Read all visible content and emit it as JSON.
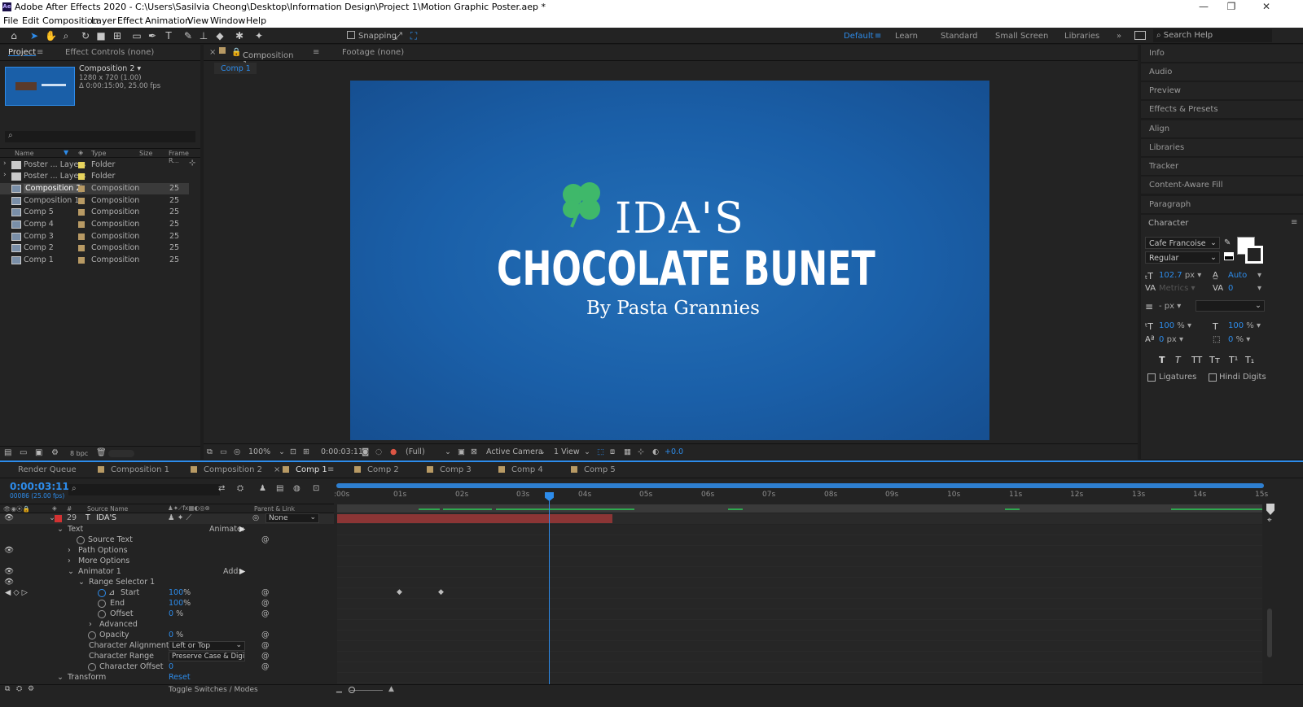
{
  "app": {
    "title": "Adobe After Effects 2020 - C:\\Users\\Sasilvia Cheong\\Desktop\\Information Design\\Project 1\\Motion Graphic Poster.aep *",
    "logo": "Ae"
  },
  "menu": [
    "File",
    "Edit",
    "Composition",
    "Layer",
    "Effect",
    "Animation",
    "View",
    "Window",
    "Help"
  ],
  "toolbar": {
    "snapping": "Snapping",
    "workspaces": [
      "Default",
      "Learn",
      "Standard",
      "Small Screen",
      "Libraries"
    ],
    "search_placeholder": "Search Help"
  },
  "project": {
    "tabs": {
      "project": "Project",
      "effect_controls": "Effect Controls (none)"
    },
    "selected": {
      "name": "Composition 2",
      "dims": "1280 x 720 (1.00)",
      "duration": "Δ 0:00:15:00, 25.00 fps"
    },
    "columns": {
      "name": "Name",
      "type": "Type",
      "size": "Size",
      "frame_rate": "Frame R..."
    },
    "items": [
      {
        "name": "Poster ... Layers",
        "type": "Folder",
        "rate": ""
      },
      {
        "name": "Poster ... Layers",
        "type": "Folder",
        "rate": ""
      },
      {
        "name": "Composition 2",
        "type": "Composition",
        "rate": "25"
      },
      {
        "name": "Composition 1",
        "type": "Composition",
        "rate": "25"
      },
      {
        "name": "Comp 5",
        "type": "Composition",
        "rate": "25"
      },
      {
        "name": "Comp 4",
        "type": "Composition",
        "rate": "25"
      },
      {
        "name": "Comp 3",
        "type": "Composition",
        "rate": "25"
      },
      {
        "name": "Comp 2",
        "type": "Composition",
        "rate": "25"
      },
      {
        "name": "Comp 1",
        "type": "Composition",
        "rate": "25"
      }
    ],
    "bpc": "8 bpc"
  },
  "viewer": {
    "tab_label": "Composition",
    "tab_comp": "Comp 1",
    "footage_tab": "Footage (none)",
    "breadcrumb": "Comp 1",
    "poster": {
      "line1": "IDA'S",
      "line2": "CHOCOLATE BUNET",
      "line3": "By Pasta Grannies"
    },
    "footer": {
      "zoom": "100%",
      "time": "0:00:03:11",
      "resolution": "(Full)",
      "camera": "Active Camera",
      "views": "1 View",
      "exposure": "+0.0"
    }
  },
  "right_panels": [
    "Info",
    "Audio",
    "Preview",
    "Effects & Presets",
    "Align",
    "Libraries",
    "Tracker",
    "Content-Aware Fill",
    "Paragraph",
    "Character"
  ],
  "character": {
    "font": "Cafe Francoise",
    "style": "Regular",
    "size": "102.7",
    "size_unit": "px",
    "leading": "Auto",
    "kerning": "Metrics",
    "tracking": "0",
    "stroke_unit": "- px",
    "vscale": "100",
    "hscale": "100",
    "pct": "%",
    "baseline": "0",
    "baseline_unit": "px",
    "tsume": "0",
    "format_buttons": [
      "T",
      "T",
      "TT",
      "Tт",
      "T¹",
      "T₁"
    ],
    "ligatures": "Ligatures",
    "hindi": "Hindi Digits"
  },
  "timeline": {
    "tabs": [
      "Render Queue",
      "Composition 1",
      "Composition 2",
      "Comp 1",
      "Comp 2",
      "Comp 3",
      "Comp 4",
      "Comp 5"
    ],
    "current_time": "0:00:03:11",
    "frame_info": "00086 (25.00 fps)",
    "columns": {
      "source": "Source Name",
      "parent": "Parent & Link",
      "num": "#"
    },
    "ruler": [
      ":00s",
      "01s",
      "02s",
      "03s",
      "04s",
      "05s",
      "06s",
      "07s",
      "08s",
      "09s",
      "10s",
      "11s",
      "12s",
      "13s",
      "14s",
      "15s"
    ],
    "layer": {
      "num": "29",
      "name": "IDA'S",
      "parent": "None"
    },
    "props": {
      "text": "Text",
      "animate": "Animate:",
      "source_text": "Source Text",
      "path_options": "Path Options",
      "more_options": "More Options",
      "animator": "Animator 1",
      "add": "Add:",
      "range": "Range Selector 1",
      "start": "Start",
      "start_val": "100",
      "end": "End",
      "end_val": "100",
      "offset": "Offset",
      "offset_val": "0",
      "pct": "%",
      "advanced": "Advanced",
      "opacity": "Opacity",
      "opacity_val": "0",
      "char_align": "Character Alignment",
      "char_align_val": "Left or Top",
      "char_range": "Character Range",
      "char_range_val": "Preserve Case & Digit",
      "char_offset": "Character Offset",
      "char_offset_val": "0",
      "transform": "Transform",
      "reset": "Reset"
    },
    "footer": "Toggle Switches / Modes"
  },
  "colors": {
    "accent": "#2d8ceb",
    "poster_bg": "#1a5fa8",
    "layer_bar": "#8b3535",
    "playhead": "#2d8ceb",
    "clover": "#3fb86a"
  }
}
